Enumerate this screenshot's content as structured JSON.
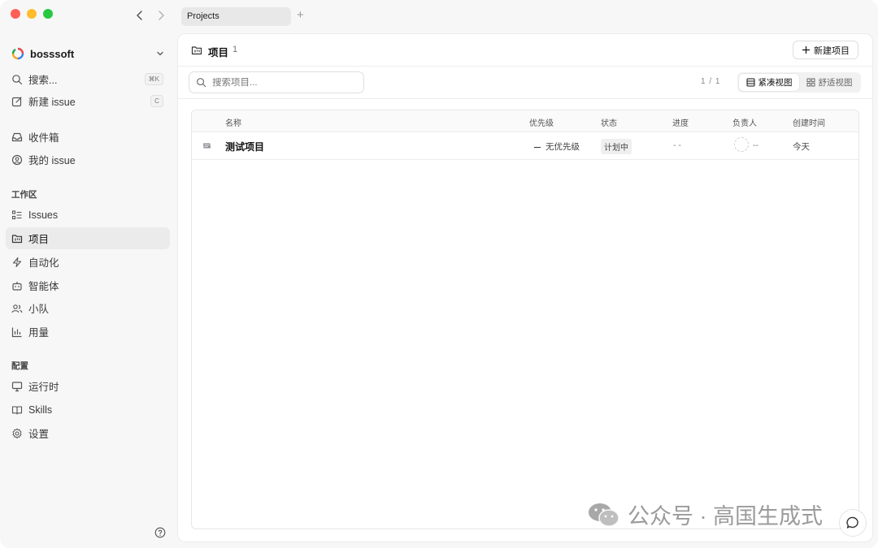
{
  "window": {
    "tab_label": "Projects",
    "tab_add": "+"
  },
  "sidebar": {
    "workspace": "bosssoft",
    "search_label": "搜索...",
    "search_shortcut": "⌘K",
    "new_issue_label": "新建 issue",
    "new_issue_shortcut": "C",
    "inbox_label": "收件箱",
    "my_issues_label": "我的 issue",
    "workspace_section": "工作区",
    "workspace_items": [
      {
        "label": "Issues",
        "icon": "list-check-icon"
      },
      {
        "label": "项目",
        "icon": "folder-kanban-icon",
        "active": true
      },
      {
        "label": "自动化",
        "icon": "zap-icon"
      },
      {
        "label": "智能体",
        "icon": "bot-icon"
      },
      {
        "label": "小队",
        "icon": "users-icon"
      },
      {
        "label": "用量",
        "icon": "bar-chart-icon"
      }
    ],
    "config_section": "配置",
    "config_items": [
      {
        "label": "运行时",
        "icon": "monitor-icon"
      },
      {
        "label": "Skills",
        "icon": "book-open-icon"
      },
      {
        "label": "设置",
        "icon": "gear-icon"
      }
    ]
  },
  "main": {
    "title": "项目",
    "count": "1",
    "new_project_label": "新建项目",
    "search_placeholder": "搜索项目...",
    "pager": "1 / 1",
    "view_compact": "紧凑视图",
    "view_comfortable": "舒适视图",
    "columns": [
      "名称",
      "优先级",
      "状态",
      "进度",
      "负责人",
      "创建时间"
    ],
    "rows": [
      {
        "name": "测试项目",
        "priority": "无优先级",
        "status": "计划中",
        "progress": "- -",
        "assignee": "--",
        "created": "今天"
      }
    ]
  },
  "watermark": "公众号 · 高国生成式"
}
